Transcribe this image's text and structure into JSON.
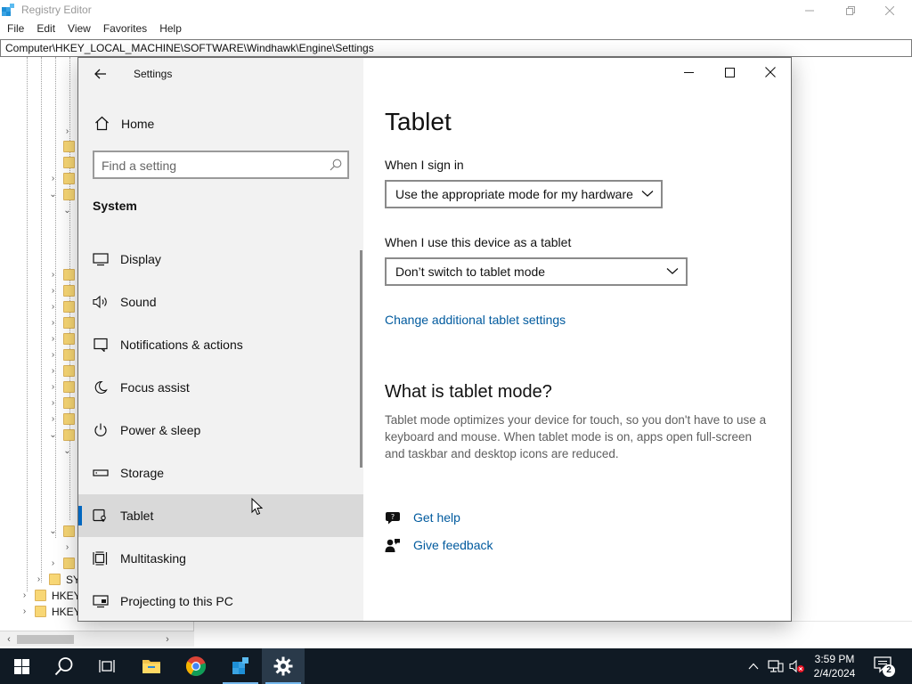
{
  "regedit": {
    "title": "Registry Editor",
    "menu": [
      "File",
      "Edit",
      "View",
      "Favorites",
      "Help"
    ],
    "address": "Computer\\HKEY_LOCAL_MACHINE\\SOFTWARE\\Windhawk\\Engine\\Settings",
    "tree_labels": [
      "SY",
      "HKEY",
      "HKEY"
    ]
  },
  "settings": {
    "window_title": "Settings",
    "home_label": "Home",
    "search_placeholder": "Find a setting",
    "section_heading": "System",
    "nav": [
      {
        "label": "Display",
        "icon": "display-icon"
      },
      {
        "label": "Sound",
        "icon": "sound-icon"
      },
      {
        "label": "Notifications & actions",
        "icon": "notifications-icon"
      },
      {
        "label": "Focus assist",
        "icon": "moon-icon"
      },
      {
        "label": "Power & sleep",
        "icon": "power-icon"
      },
      {
        "label": "Storage",
        "icon": "storage-icon"
      },
      {
        "label": "Tablet",
        "icon": "tablet-icon",
        "selected": true
      },
      {
        "label": "Multitasking",
        "icon": "multitasking-icon"
      },
      {
        "label": "Projecting to this PC",
        "icon": "projecting-icon"
      }
    ],
    "page": {
      "title": "Tablet",
      "sign_in_label": "When I sign in",
      "sign_in_value": "Use the appropriate mode for my hardware",
      "tablet_use_label": "When I use this device as a tablet",
      "tablet_use_value": "Don’t switch to tablet mode",
      "additional_link": "Change additional tablet settings",
      "what_is_heading": "What is tablet mode?",
      "what_is_desc": "Tablet mode optimizes your device for touch, so you don't have to use a keyboard and mouse. When tablet mode is on, apps open full-screen and taskbar and desktop icons are reduced.",
      "get_help": "Get help",
      "give_feedback": "Give feedback"
    }
  },
  "taskbar": {
    "time": "3:59 PM",
    "date": "2/4/2024",
    "notification_count": "2",
    "accent": "#76b9ed"
  },
  "colors": {
    "link": "#005a9e",
    "selection_accent": "#0067c0",
    "taskbar_bg": "#101a24"
  }
}
